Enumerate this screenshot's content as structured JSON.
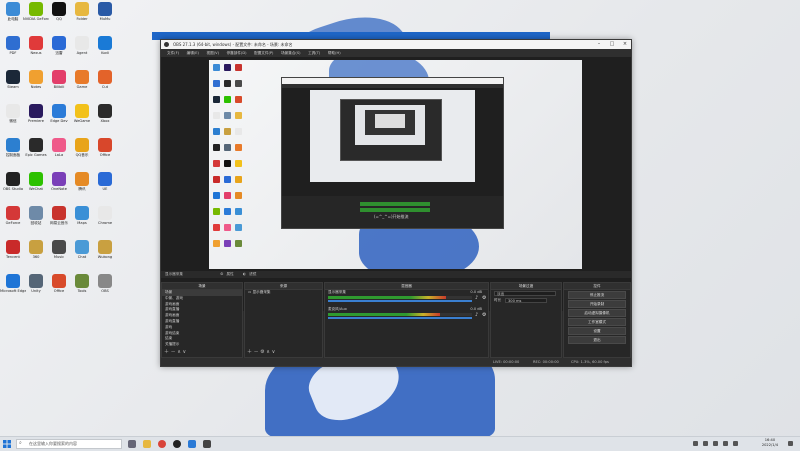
{
  "desktop": {
    "icons": [
      {
        "label": "此电脑",
        "color": "#3b8bd6"
      },
      {
        "label": "PDF",
        "color": "#2f6ed1"
      },
      {
        "label": "Steam",
        "color": "#1b2838"
      },
      {
        "label": "微信",
        "color": "#e8e8e8"
      },
      {
        "label": "控制面板",
        "color": "#2c7fd0"
      },
      {
        "label": "OBS Studio",
        "color": "#222"
      },
      {
        "label": "GeForce",
        "color": "#d43838"
      },
      {
        "label": "Tencent",
        "color": "#c92a2a"
      },
      {
        "label": "Microsoft Edge",
        "color": "#1e74d6"
      },
      {
        "label": "NVIDIA GeForce",
        "color": "#76b900"
      },
      {
        "label": "Nexus",
        "color": "#e03a3a"
      },
      {
        "label": "Notes",
        "color": "#f0a030"
      },
      {
        "label": "Premiere",
        "color": "#2a1a5e"
      },
      {
        "label": "Epic Games",
        "color": "#2a2a2a"
      },
      {
        "label": "WeChat",
        "color": "#2dc100"
      },
      {
        "label": "回收站",
        "color": "#6e8aa8"
      },
      {
        "label": "360",
        "color": "#c8a040"
      },
      {
        "label": "Unity",
        "color": "#556677"
      },
      {
        "label": "QQ",
        "color": "#111"
      },
      {
        "label": "迅雷",
        "color": "#2a6ad6"
      },
      {
        "label": "Bilibili",
        "color": "#e33e6a"
      },
      {
        "label": "Edge Dev",
        "color": "#2b7bd8"
      },
      {
        "label": "LaLa",
        "color": "#ef5a8a"
      },
      {
        "label": "OneNote",
        "color": "#7a3fb8"
      },
      {
        "label": "网易云音乐",
        "color": "#c8332d"
      },
      {
        "label": "Music",
        "color": "#4a4a4a"
      },
      {
        "label": "Office",
        "color": "#d84a2a"
      },
      {
        "label": "Folder",
        "color": "#e7b840"
      },
      {
        "label": "Agent",
        "color": "#e8e8e8"
      },
      {
        "label": "Game",
        "color": "#e87a2a"
      },
      {
        "label": "WeGame",
        "color": "#f2c11a"
      },
      {
        "label": "QQ音乐",
        "color": "#e8a41a"
      },
      {
        "label": "腾讯",
        "color": "#e58a25"
      },
      {
        "label": "Maps",
        "color": "#3a8fd6"
      },
      {
        "label": "Chat",
        "color": "#4a9ad6"
      },
      {
        "label": "Tools",
        "color": "#6a8a3a"
      },
      {
        "label": "MuMu",
        "color": "#2a5aa6"
      },
      {
        "label": "Kodi",
        "color": "#1a7ad6"
      },
      {
        "label": "Cut",
        "color": "#e3632a"
      },
      {
        "label": "Xbox",
        "color": "#2b2b2b"
      },
      {
        "label": "Office",
        "color": "#d8472b"
      },
      {
        "label": "UE",
        "color": "#2a6ad6"
      },
      {
        "label": "Chrome",
        "color": "#e8e8e8"
      },
      {
        "label": "Wukong",
        "color": "#c9a040"
      },
      {
        "label": "OBS",
        "color": "#888"
      }
    ]
  },
  "taskbar": {
    "search_placeholder": "在这里输入你要搜索的内容",
    "time": "16:40",
    "date": "2022/1/4"
  },
  "obs": {
    "title": "OBS 27.1.3 (64-bit, windows) - 配置文件: 未命名 - 场景: 未命名",
    "menu": [
      "文件(F)",
      "编辑(E)",
      "视图(V)",
      "停靠部件(D)",
      "配置文件(P)",
      "场景集合(S)",
      "工具(T)",
      "帮助(H)"
    ],
    "source_bar": {
      "name": "显示器采集",
      "properties": "属性",
      "filters": "滤镜"
    },
    "scenes": {
      "title": "场景",
      "items": [
        "场景",
        "中景、游戏",
        "游戏画面",
        "游戏直播",
        "游戏画面",
        "游戏直播",
        "游戏",
        "游戏结束",
        "结束",
        "关播提示"
      ]
    },
    "sources": {
      "title": "来源",
      "items": [
        "显示器采集"
      ]
    },
    "mixer": {
      "title": "混音器",
      "channels": [
        {
          "name": "显示器采集",
          "db": "0.0 dB",
          "level": 0.82
        },
        {
          "name": "麦克风/Aux",
          "db": "0.0 dB",
          "level": 0.78
        }
      ]
    },
    "transitions": {
      "title": "场景过渡",
      "type_label": "淡出",
      "duration_label": "时长",
      "duration": "300 ms"
    },
    "controls": {
      "title": "控件",
      "buttons": [
        "停止推流",
        "开始录制",
        "启动虚拟摄像机",
        "工作室模式",
        "设置",
        "退出"
      ]
    },
    "status": {
      "live": "LIVE: 00:00:00",
      "rec": "REC: 00:00:00",
      "cpu": "CPU: 1.3%, 60.00 fps"
    },
    "inner_text": "(=^_^=)开始推流"
  }
}
